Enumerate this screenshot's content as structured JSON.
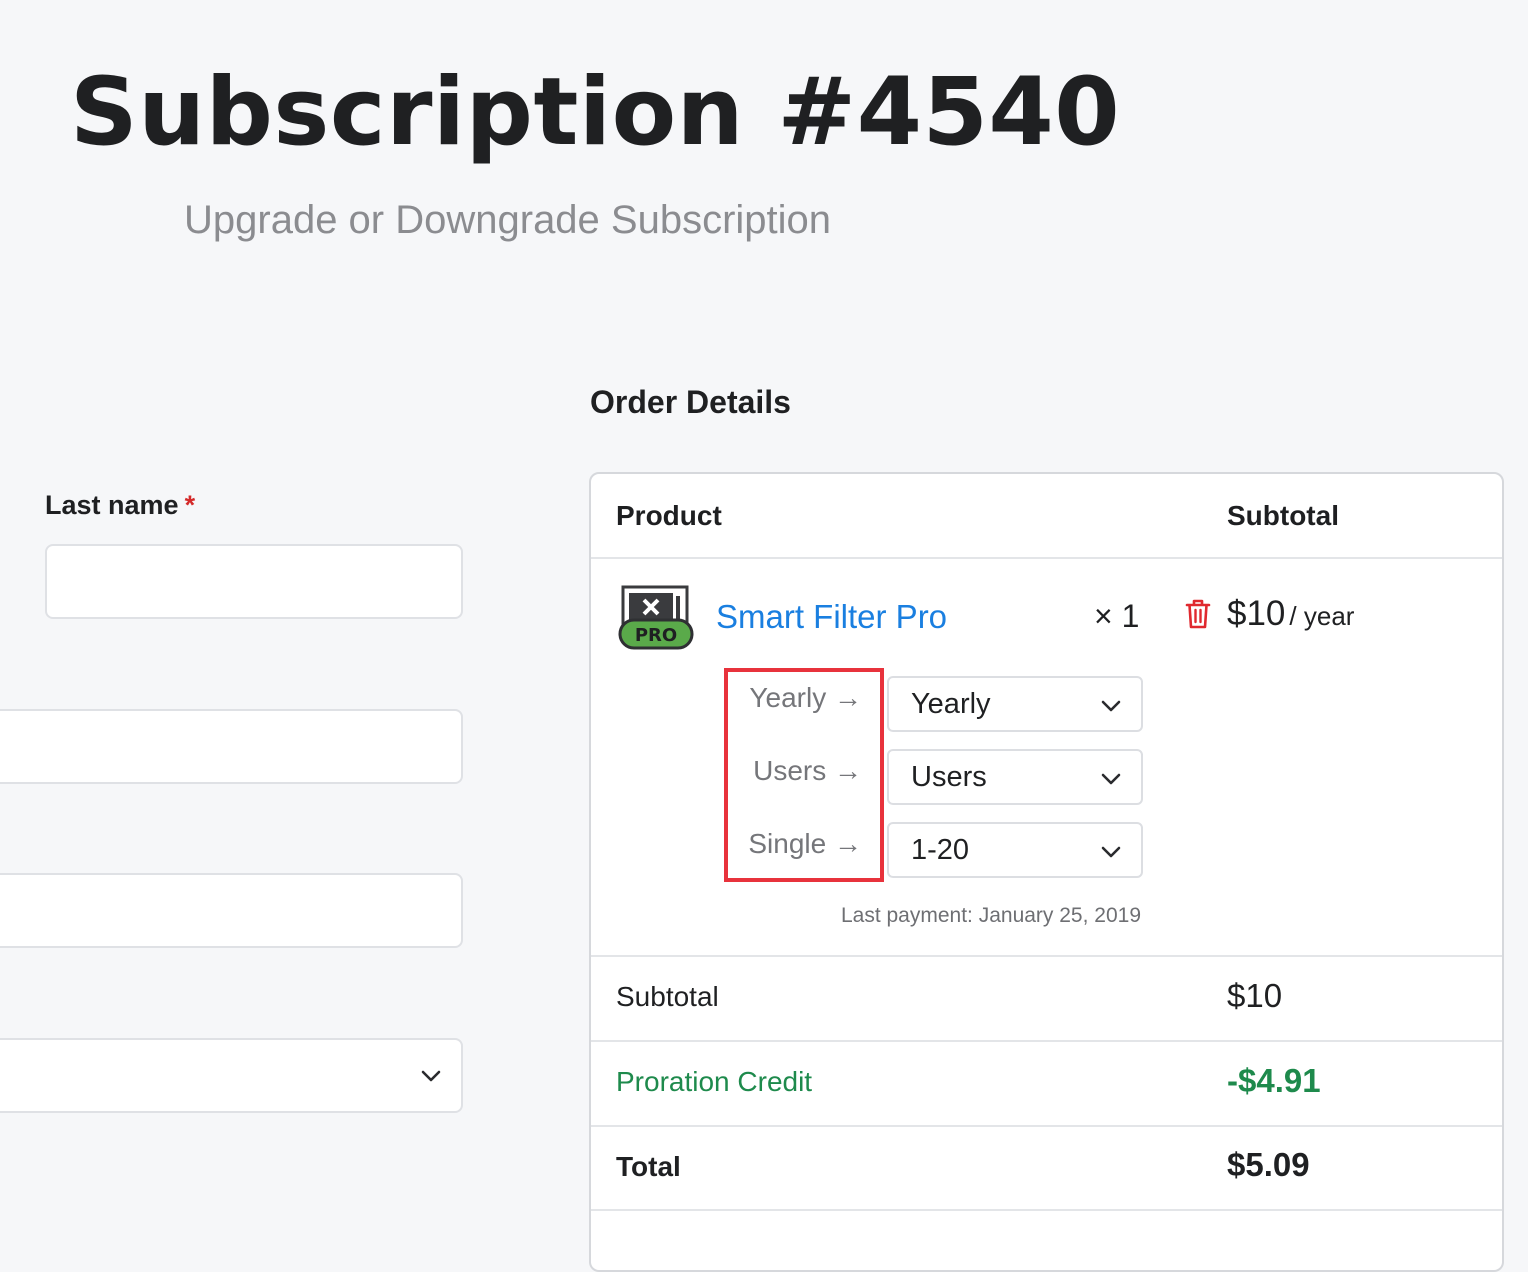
{
  "page": {
    "title": "Subscription #4540",
    "subtitle": "Upgrade or Downgrade Subscription"
  },
  "form": {
    "last_name_label": "Last name",
    "required_mark": "*",
    "last_name_value": "",
    "field2_value": "",
    "field3_value": "",
    "select_value": ""
  },
  "order": {
    "heading": "Order Details",
    "columns": {
      "product": "Product",
      "subtotal": "Subtotal"
    },
    "item": {
      "name": "Smart Filter Pro",
      "icon_badge": "PRO",
      "quantity": "× 1",
      "price": "$10",
      "price_period": "/ year",
      "options": [
        {
          "label": "Yearly →",
          "selected": "Yearly"
        },
        {
          "label": "Users →",
          "selected": "Users"
        },
        {
          "label": "Single →",
          "selected": "1-20"
        }
      ],
      "last_payment": "Last payment: January 25, 2019"
    },
    "summary": {
      "subtotal_label": "Subtotal",
      "subtotal_value": "$10",
      "credit_label": "Proration Credit",
      "credit_value": "-$4.91",
      "total_label": "Total",
      "total_value": "$5.09"
    }
  },
  "colors": {
    "accent_link": "#1a7fe0",
    "credit_green": "#1e8a4c",
    "required_red": "#d42a2a",
    "highlight_red": "#e8323c",
    "pro_badge_green": "#5aaa4a"
  }
}
